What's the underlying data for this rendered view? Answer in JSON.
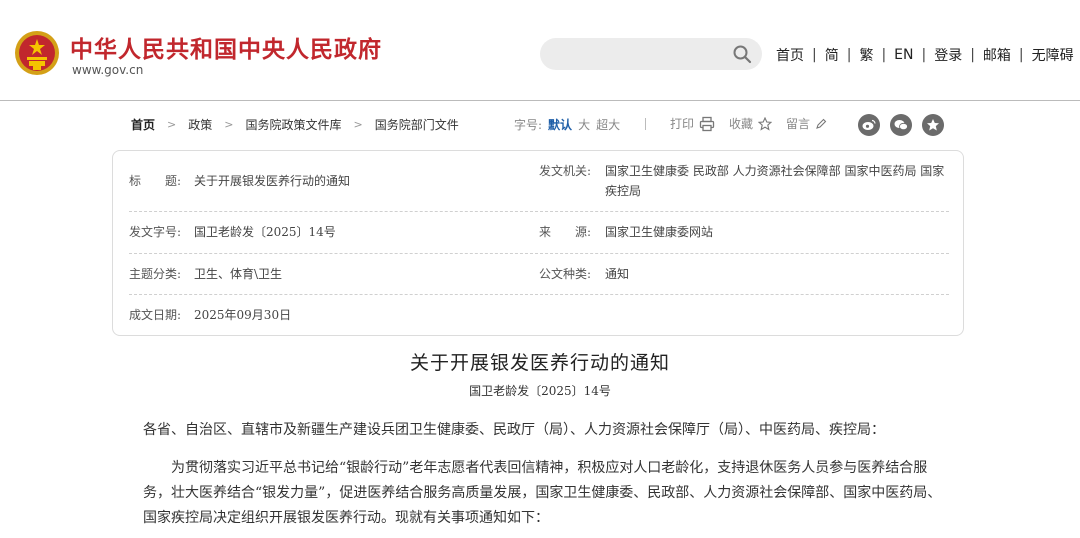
{
  "header": {
    "site_title": "中华人民共和国中央人民政府",
    "site_url": "www.gov.cn",
    "search": {
      "placeholder": "",
      "icon": "search-icon"
    },
    "nav": [
      "首页",
      "简",
      "繁",
      "EN",
      "登录",
      "邮箱",
      "无障碍"
    ],
    "brand_color": "#c1272d"
  },
  "breadcrumb": [
    "首页",
    "政策",
    "国务院政策文件库",
    "国务院部门文件"
  ],
  "toolbar": {
    "fontsize_label": "字号:",
    "fontsize_options": [
      "默认",
      "大",
      "超大"
    ],
    "print_label": "打印",
    "favorite_label": "收藏",
    "comment_label": "留言",
    "share_icons": [
      "weibo-icon",
      "wechat-icon",
      "qzone-icon"
    ]
  },
  "info": {
    "title_label": "标　　题:",
    "title_value": "关于开展银发医养行动的通知",
    "issuer_label": "发文机关:",
    "issuer_value": "国家卫生健康委  民政部  人力资源社会保障部  国家中医药局  国家疾控局",
    "docno_label": "发文字号:",
    "docno_value": "国卫老龄发〔2025〕14号",
    "source_label": "来　　源:",
    "source_value": "国家卫生健康委网站",
    "topic_label": "主题分类:",
    "topic_value": "卫生、体育\\卫生",
    "doctype_label": "公文种类:",
    "doctype_value": "通知",
    "date_label": "成文日期:",
    "date_value": "2025年09月30日"
  },
  "article": {
    "title": "关于开展银发医养行动的通知",
    "doc_number": "国卫老龄发〔2025〕14号",
    "paragraphs": [
      "各省、自治区、直辖市及新疆生产建设兵团卫生健康委、民政厅（局）、人力资源社会保障厅（局）、中医药局、疾控局：",
      "为贯彻落实习近平总书记给“银龄行动”老年志愿者代表回信精神，积极应对人口老龄化，支持退休医务人员参与医养结合服务，壮大医养结合“银发力量”，促进医养结合服务高质量发展，国家卫生健康委、民政部、人力资源社会保障部、国家中医药局、国家疾控局决定组织开展银发医养行动。现就有关事项通知如下："
    ]
  }
}
